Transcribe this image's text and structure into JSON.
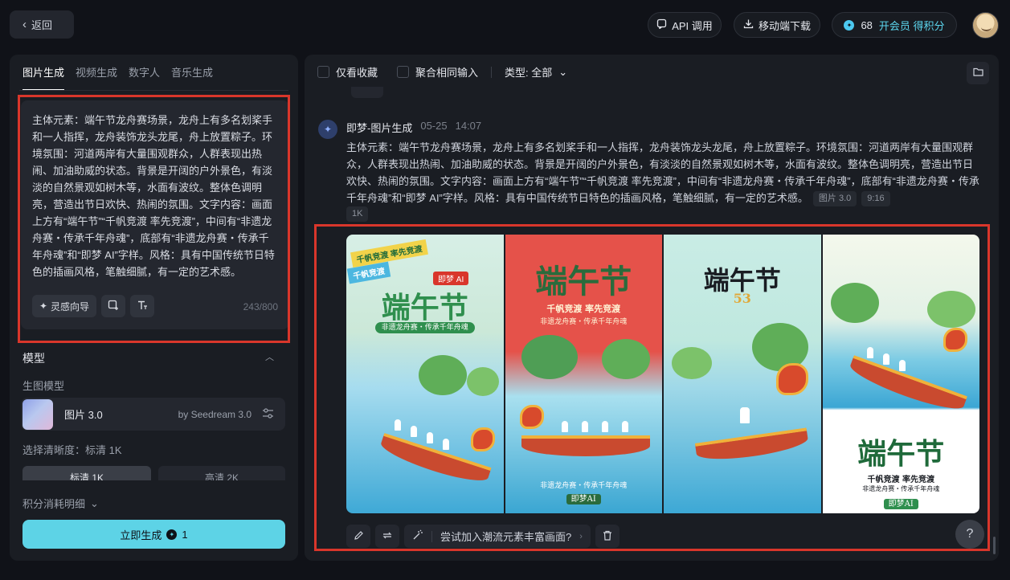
{
  "topbar": {
    "back_label": "返回",
    "api_label": "API 调用",
    "download_label": "移动端下载",
    "credits": "68",
    "member_label": "开会员 得积分"
  },
  "left": {
    "tabs": [
      {
        "label": "图片生成",
        "active": true
      },
      {
        "label": "视频生成",
        "active": false
      },
      {
        "label": "数字人",
        "active": false
      },
      {
        "label": "音乐生成",
        "active": false
      }
    ],
    "prompt": "主体元素：端午节龙舟赛场景，龙舟上有多名划桨手和一人指挥，龙舟装饰龙头龙尾，舟上放置粽子。环境氛围：河道两岸有大量围观群众，人群表现出热闹、加油助威的状态。背景是开阔的户外景色，有淡淡的自然景观如树木等，水面有波纹。整体色调明亮，营造出节日欢快、热闹的氛围。文字内容：画面上方有“端午节”“千帆竞渡 率先竞渡”，中间有“非遗龙舟赛・传承千年舟魂”，底部有“非遗龙舟赛・传承千年舟魂”和“即梦 AI”字样。风格：具有中国传统节日特色的插画风格，笔触细腻，有一定的艺术感。",
    "inspire_label": "灵感向导",
    "char_count": "243/800",
    "model_section_title": "模型",
    "gen_model_label": "生图模型",
    "model_name": "图片 3.0",
    "model_by": "by Seedream 3.0",
    "resolution_label": "选择清晰度：标清 1K",
    "quality_std": "标清 1K",
    "quality_hd": "高清 2K",
    "credit_detail_label": "积分消耗明细",
    "generate_label": "立即生成",
    "generate_cost": "1"
  },
  "right": {
    "filter_fav": "仅看收藏",
    "filter_merge": "聚合相同输入",
    "filter_type": "类型: 全部",
    "message": {
      "author": "即梦-图片生成",
      "date": "05-25",
      "time": "14:07",
      "body": "主体元素：端午节龙舟赛场景，龙舟上有多名划桨手和一人指挥，龙舟装饰龙头龙尾，舟上放置粽子。环境氛围：河道两岸有大量围观群众，人群表现出热闹、加油助威的状态。背景是开阔的户外景色，有淡淡的自然景观如树木等，水面有波纹。整体色调明亮，营造出节日欢快、热闹的氛围。文字内容：画面上方有“端午节”“千帆竞渡 率先竞渡”，中间有“非遗龙舟赛・传承千年舟魂”，底部有“非遗龙舟赛・传承千年舟魂”和“即梦 AI”字样。风格：具有中国传统节日特色的插画风格，笔触细腻，有一定的艺术感。",
      "chip_model": "图片 3.0",
      "chip_ratio": "9:16",
      "chip_res": "1K"
    },
    "posters": [
      {
        "title": "端午节",
        "banner1": "千帆竞渡 率先竞渡",
        "banner2": "千帆竞渡",
        "sub": "非遗龙舟赛・传承千年舟魂",
        "logo": "即梦 AI"
      },
      {
        "title": "端午节",
        "sub1": "千帆竞渡 率先竞渡",
        "sub2": "非遗龙舟赛・传承千年舟魂",
        "footer": "非遗龙舟赛・传承千年舟魂",
        "logo": "即梦AI"
      },
      {
        "title": "端午节",
        "number": "53"
      },
      {
        "title": "端午节",
        "sub1": "千帆竞渡 率先竞渡",
        "sub2": "非遗龙舟赛・传承千年舟魂",
        "logo": "即梦AI"
      }
    ],
    "suggest_label": "尝试加入潮流元素丰富画面?"
  },
  "colors": {
    "accent": "#5dd3e6",
    "highlight_frame": "#d9362b",
    "background": "#101218",
    "panel": "#1a1d23"
  }
}
